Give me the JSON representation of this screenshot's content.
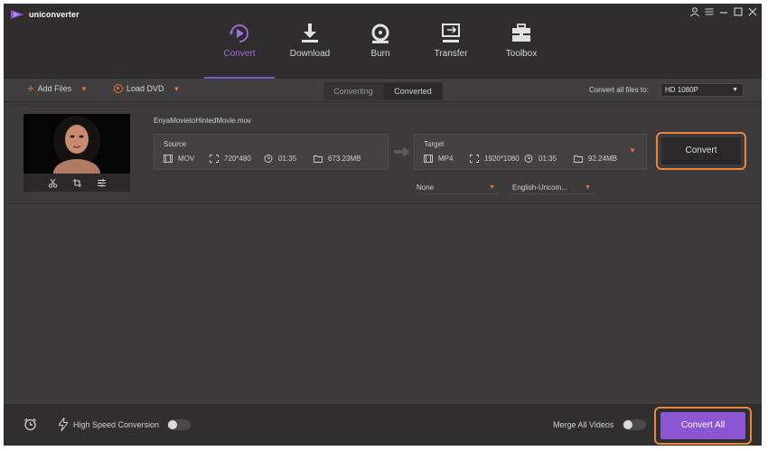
{
  "app": {
    "title": "uniconverter",
    "accent": "#8456c7",
    "orange": "#e27239"
  },
  "window_controls": [
    "account-icon",
    "menu-icon",
    "minimize-icon",
    "maximize-icon",
    "close-icon"
  ],
  "nav": [
    {
      "label": "Convert",
      "icon": "convert-icon",
      "active": true
    },
    {
      "label": "Download",
      "icon": "download-icon"
    },
    {
      "label": "Burn",
      "icon": "burn-icon"
    },
    {
      "label": "Transfer",
      "icon": "transfer-icon"
    },
    {
      "label": "Toolbox",
      "icon": "toolbox-icon"
    }
  ],
  "toolbar": {
    "add_files": "Add Files",
    "load_dvd": "Load DVD",
    "tabs": [
      "Converting",
      "Converted"
    ],
    "convert_all_files_to": "Convert all files to:",
    "preset": "HD 1080P"
  },
  "file": {
    "name": "EnyaMovietoHintedMovie.mov",
    "source": {
      "title": "Source",
      "format": "MOV",
      "resolution": "720*480",
      "duration": "01:35",
      "size": "673.23MB"
    },
    "target": {
      "title": "Target",
      "format": "MP4",
      "resolution": "1920*1080",
      "duration": "01:35",
      "size": "92.24MB"
    },
    "subtitle": "None",
    "audio": "English-Uncom...",
    "convert_label": "Convert",
    "tools": [
      "cut-icon",
      "crop-icon",
      "effects-icon"
    ]
  },
  "bottom": {
    "high_speed": "High Speed Conversion",
    "merge": "Merge All Videos",
    "convert_all": "Convert All"
  }
}
